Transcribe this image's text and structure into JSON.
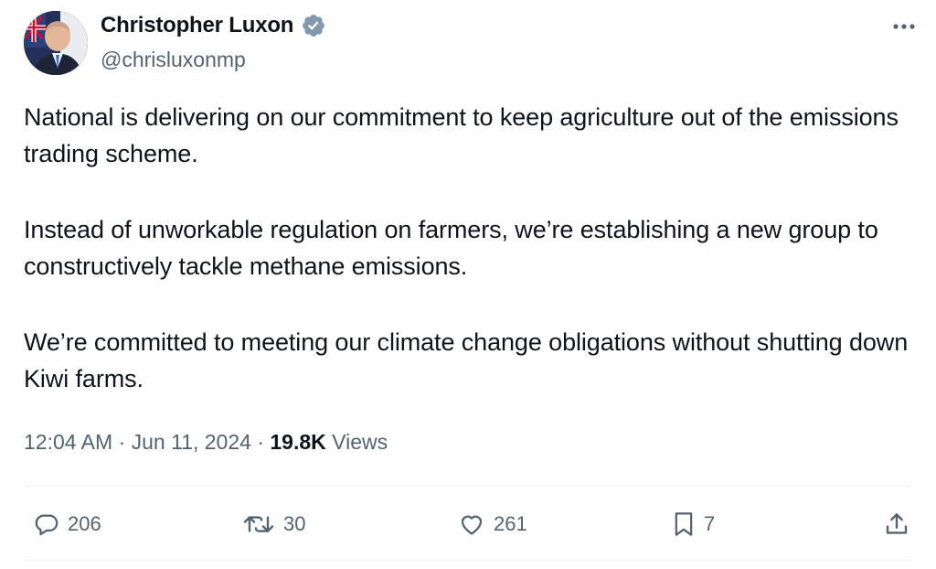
{
  "author": {
    "name": "Christopher Luxon",
    "handle": "@chrisluxonmp",
    "verified": true
  },
  "tweet": {
    "paragraphs": [
      "National is delivering on our commitment to keep agriculture out of the emissions trading scheme.",
      "Instead of unworkable regulation on farmers, we’re establishing a new group to constructively tackle methane emissions.",
      "We’re committed to meeting our climate change obligations without shutting down Kiwi farms."
    ]
  },
  "meta": {
    "time": "12:04 AM",
    "separator": "·",
    "date": "Jun 11, 2024",
    "views_count": "19.8K",
    "views_label": "Views"
  },
  "actions": {
    "replies": "206",
    "reposts": "30",
    "likes": "261",
    "bookmarks": "7"
  },
  "icons": {
    "verified": "verified-badge-icon",
    "more": "more-horizontal-icon",
    "reply": "reply-bubble-icon",
    "repost": "repost-arrows-icon",
    "like": "heart-icon",
    "bookmark": "bookmark-icon",
    "share": "share-upload-icon"
  },
  "colors": {
    "text": "#0f1419",
    "secondary": "#536471",
    "divider": "#eff3f4",
    "badge": "#829aab"
  }
}
